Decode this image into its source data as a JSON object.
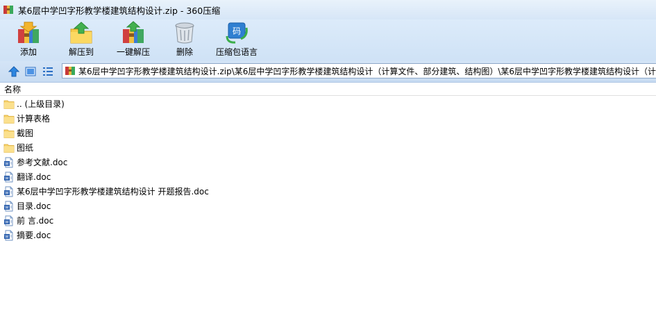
{
  "window": {
    "title": "某6层中学凹字形教学楼建筑结构设计.zip - 360压缩"
  },
  "toolbar": {
    "add": "添加",
    "extract_to": "解压到",
    "one_click_extract": "一键解压",
    "delete": "删除",
    "language": "压缩包语言"
  },
  "address": {
    "path": "某6层中学凹字形教学楼建筑结构设计.zip\\某6层中学凹字形教学楼建筑结构设计（计算文件、部分建筑、结构图）\\某6层中学凹字形教学楼建筑结构设计（计"
  },
  "list": {
    "column_name": "名称",
    "items": [
      {
        "name": ".. (上级目录)",
        "type": "folder"
      },
      {
        "name": "计算表格",
        "type": "folder"
      },
      {
        "name": "截图",
        "type": "folder"
      },
      {
        "name": "图纸",
        "type": "folder"
      },
      {
        "name": "参考文献.doc",
        "type": "doc"
      },
      {
        "name": "翻译.doc",
        "type": "doc"
      },
      {
        "name": "某6层中学凹字形教学楼建筑结构设计 开题报告.doc",
        "type": "doc"
      },
      {
        "name": "目录.doc",
        "type": "doc"
      },
      {
        "name": "前 言.doc",
        "type": "doc"
      },
      {
        "name": "摘要.doc",
        "type": "doc"
      }
    ]
  }
}
